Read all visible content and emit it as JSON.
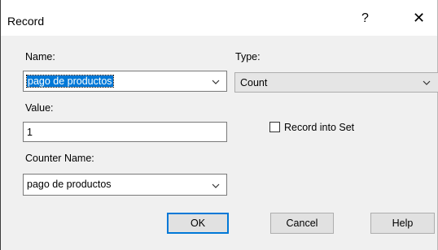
{
  "window": {
    "title": "Record",
    "help_glyph": "?",
    "close_glyph": "✕"
  },
  "form": {
    "name": {
      "label": "Name:",
      "value": "pago de productos"
    },
    "type": {
      "label": "Type:",
      "value": "Count"
    },
    "value": {
      "label": "Value:",
      "value": "1"
    },
    "record_into_set": {
      "label": "Record into Set",
      "checked": false
    },
    "counter_name": {
      "label": "Counter Name:",
      "value": "pago de productos"
    }
  },
  "buttons": {
    "ok": "OK",
    "cancel": "Cancel",
    "help": "Help"
  },
  "colors": {
    "accent": "#0078d7",
    "dialog_bg": "#f0f0f0",
    "button_bg": "#e1e1e1"
  },
  "icons": {
    "dropdown": "chevron-down-icon",
    "close": "close-icon",
    "help": "help-icon"
  }
}
